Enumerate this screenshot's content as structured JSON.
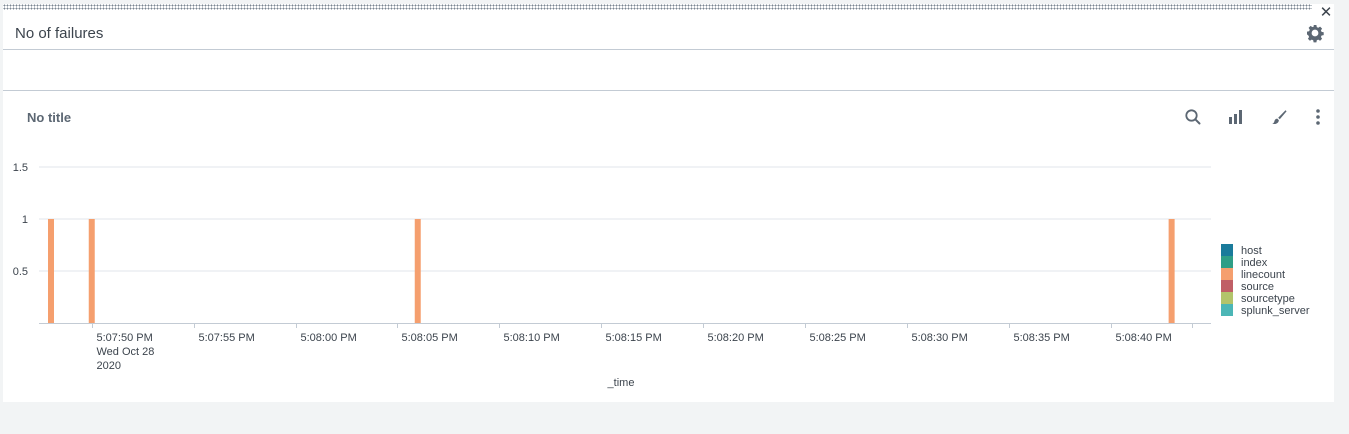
{
  "panel": {
    "title": "No of failures",
    "close_icon": "close-icon",
    "settings_icon": "gear-icon"
  },
  "visualization": {
    "title": "No title",
    "tools": [
      "search-icon",
      "bar-chart-icon",
      "brush-icon",
      "more-vertical-icon"
    ]
  },
  "colors": {
    "linecount": "#f59f6e",
    "grid": "#e1e6eb",
    "axis": "#c3cbd4"
  },
  "chart_data": {
    "type": "bar",
    "title": "",
    "xlabel": "_time",
    "ylabel": "",
    "ylim": [
      0,
      1.5
    ],
    "y_ticks": [
      "0.5",
      "1",
      "1.5"
    ],
    "x_range": [
      "5:07:48 PM",
      "5:08:44 PM"
    ],
    "x_ticks": [
      {
        "time": "5:07:50 PM",
        "label": [
          "5:07:50 PM",
          "Wed Oct 28",
          "2020"
        ]
      },
      {
        "time": "5:07:55 PM",
        "label": [
          "5:07:55 PM"
        ]
      },
      {
        "time": "5:08:00 PM",
        "label": [
          "5:08:00 PM"
        ]
      },
      {
        "time": "5:08:05 PM",
        "label": [
          "5:08:05 PM"
        ]
      },
      {
        "time": "5:08:10 PM",
        "label": [
          "5:08:10 PM"
        ]
      },
      {
        "time": "5:08:15 PM",
        "label": [
          "5:08:15 PM"
        ]
      },
      {
        "time": "5:08:20 PM",
        "label": [
          "5:08:20 PM"
        ]
      },
      {
        "time": "5:08:25 PM",
        "label": [
          "5:08:25 PM"
        ]
      },
      {
        "time": "5:08:30 PM",
        "label": [
          "5:08:30 PM"
        ]
      },
      {
        "time": "5:08:35 PM",
        "label": [
          "5:08:35 PM"
        ]
      },
      {
        "time": "5:08:40 PM",
        "label": [
          "5:08:40 PM"
        ]
      }
    ],
    "series": [
      {
        "name": "host",
        "color": "#1a7b9b",
        "points": []
      },
      {
        "name": "index",
        "color": "#2f9e86",
        "points": []
      },
      {
        "name": "linecount",
        "color": "#f59f6e",
        "points": [
          {
            "x": "5:07:48 PM",
            "y": 1
          },
          {
            "x": "5:07:50 PM",
            "y": 1
          },
          {
            "x": "5:08:06 PM",
            "y": 1
          },
          {
            "x": "5:08:43 PM",
            "y": 1
          }
        ]
      },
      {
        "name": "source",
        "color": "#c05f66",
        "points": []
      },
      {
        "name": "sourcetype",
        "color": "#b3c46b",
        "points": []
      },
      {
        "name": "splunk_server",
        "color": "#4cb6b6",
        "points": []
      }
    ],
    "legend_position": "right",
    "grid": true
  }
}
